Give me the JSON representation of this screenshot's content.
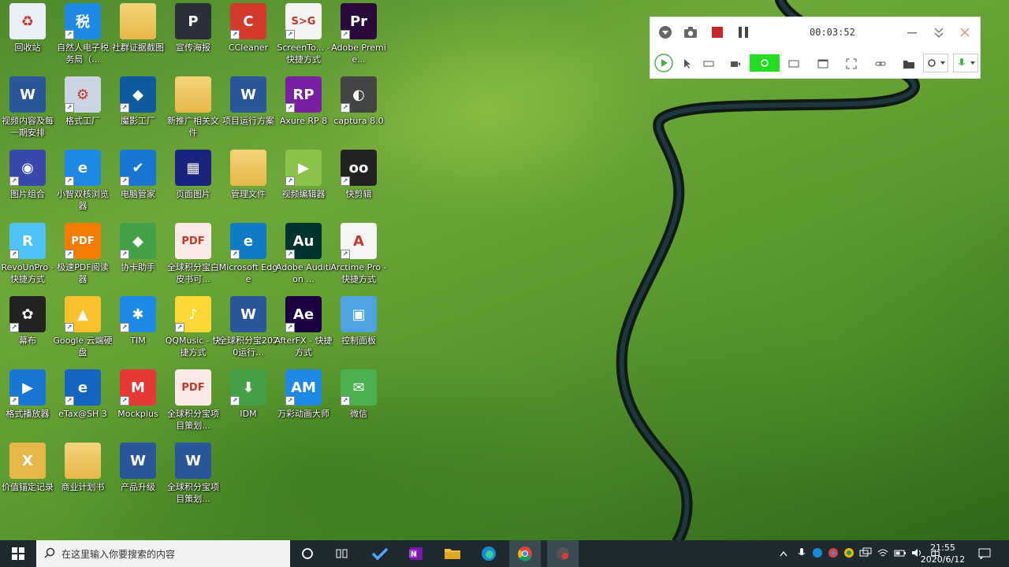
{
  "desktop_icons": [
    {
      "label": "回收站",
      "color": "#e8eef5",
      "glyph": "♻",
      "shortcut": false
    },
    {
      "label": "自然人电子税务局（...",
      "color": "#1e88e5",
      "glyph": "税",
      "shortcut": true
    },
    {
      "label": "社群证据截图",
      "color": "#e6b84a",
      "glyph": "",
      "shortcut": false
    },
    {
      "label": "宣传海报",
      "color": "#2b2f3a",
      "glyph": "P",
      "shortcut": false
    },
    {
      "label": "CCleaner",
      "color": "#d33a2c",
      "glyph": "C",
      "shortcut": true
    },
    {
      "label": "ScreenTo... - 快捷方式",
      "color": "#f4f4f4",
      "glyph": "S>G",
      "shortcut": true
    },
    {
      "label": "Adobe Premie...",
      "color": "#2a0a3a",
      "glyph": "Pr",
      "shortcut": true
    },
    {
      "label": "视频内容及每一期安排",
      "color": "#2b579a",
      "glyph": "W",
      "shortcut": false
    },
    {
      "label": "格式工厂",
      "color": "#c9d6e2",
      "glyph": "⚙",
      "shortcut": true
    },
    {
      "label": "魔影工厂",
      "color": "#0f5a9c",
      "glyph": "◆",
      "shortcut": true
    },
    {
      "label": "新推广相关文件",
      "color": "#e6b84a",
      "glyph": "",
      "shortcut": false
    },
    {
      "label": "项目运行方案",
      "color": "#2b579a",
      "glyph": "W",
      "shortcut": false
    },
    {
      "label": "Axure RP 8",
      "color": "#7b1fa2",
      "glyph": "RP",
      "shortcut": true
    },
    {
      "label": "captura 8.0",
      "color": "#444",
      "glyph": "◐",
      "shortcut": true
    },
    {
      "label": "图片组合",
      "color": "#3949ab",
      "glyph": "◉",
      "shortcut": true
    },
    {
      "label": "小智双核浏览器",
      "color": "#1e88e5",
      "glyph": "e",
      "shortcut": true
    },
    {
      "label": "电脑管家",
      "color": "#1976d2",
      "glyph": "✔",
      "shortcut": true
    },
    {
      "label": "页面图片",
      "color": "#1a237e",
      "glyph": "▦",
      "shortcut": false
    },
    {
      "label": "管理文件",
      "color": "#e6b84a",
      "glyph": "",
      "shortcut": false
    },
    {
      "label": "视频编辑器",
      "color": "#8bc34a",
      "glyph": "▶",
      "shortcut": true
    },
    {
      "label": "快剪辑",
      "color": "#222",
      "glyph": "oo",
      "shortcut": true
    },
    {
      "label": "RevoUnPro - 快捷方式",
      "color": "#4fc3f7",
      "glyph": "R",
      "shortcut": true
    },
    {
      "label": "极速PDF阅读器",
      "color": "#f57c00",
      "glyph": "PDF",
      "shortcut": true
    },
    {
      "label": "协卡助手",
      "color": "#43a047",
      "glyph": "◆",
      "shortcut": true
    },
    {
      "label": "全球积分宝白皮书可...",
      "color": "#fbe9e7",
      "glyph": "PDF",
      "shortcut": false
    },
    {
      "label": "Microsoft Edge",
      "color": "#0f7bc4",
      "glyph": "e",
      "shortcut": true
    },
    {
      "label": "Adobe Audition ...",
      "color": "#00332e",
      "glyph": "Au",
      "shortcut": true
    },
    {
      "label": "Arctime Pro - 快捷方式",
      "color": "#f5f5f5",
      "glyph": "A",
      "shortcut": true
    },
    {
      "label": "幕布",
      "color": "#222",
      "glyph": "✿",
      "shortcut": true
    },
    {
      "label": "Google 云端硬盘",
      "color": "#fbc02d",
      "glyph": "▲",
      "shortcut": true
    },
    {
      "label": "TIM",
      "color": "#1e88e5",
      "glyph": "✱",
      "shortcut": true
    },
    {
      "label": "QQMusic - 快捷方式",
      "color": "#fdd835",
      "glyph": "♪",
      "shortcut": true
    },
    {
      "label": "全球积分宝2020运行...",
      "color": "#2b579a",
      "glyph": "W",
      "shortcut": false
    },
    {
      "label": "AfterFX - 快捷方式",
      "color": "#1a0040",
      "glyph": "Ae",
      "shortcut": true
    },
    {
      "label": "控制面板",
      "color": "#4fa3e0",
      "glyph": "▣",
      "shortcut": false
    },
    {
      "label": "格式播放器",
      "color": "#1976d2",
      "glyph": "▶",
      "shortcut": true
    },
    {
      "label": "eTax@SH 3",
      "color": "#1565c0",
      "glyph": "e",
      "shortcut": true
    },
    {
      "label": "Mockplus",
      "color": "#e53935",
      "glyph": "M",
      "shortcut": true
    },
    {
      "label": "全球积分宝项目策划...",
      "color": "#fbe9e7",
      "glyph": "PDF",
      "shortcut": false
    },
    {
      "label": "IDM",
      "color": "#43a047",
      "glyph": "⬇",
      "shortcut": true
    },
    {
      "label": "万彩动画大师",
      "color": "#1e88e5",
      "glyph": "AM",
      "shortcut": true
    },
    {
      "label": "微信",
      "color": "#4caf50",
      "glyph": "✉",
      "shortcut": true
    },
    {
      "label": "价值锚定记录",
      "color": "#e6b84a",
      "glyph": "X",
      "shortcut": false
    },
    {
      "label": "商业计划书",
      "color": "#e6b84a",
      "glyph": "",
      "shortcut": false
    },
    {
      "label": "产品升级",
      "color": "#2b579a",
      "glyph": "W",
      "shortcut": false
    },
    {
      "label": "全球积分宝项目策划...",
      "color": "#2b579a",
      "glyph": "W",
      "shortcut": false
    }
  ],
  "recorder": {
    "time": "00:03:52"
  },
  "taskbar": {
    "search_placeholder": "在这里输入你要搜索的内容",
    "ime": "中",
    "time": "21:55",
    "date": "2020/6/12"
  }
}
